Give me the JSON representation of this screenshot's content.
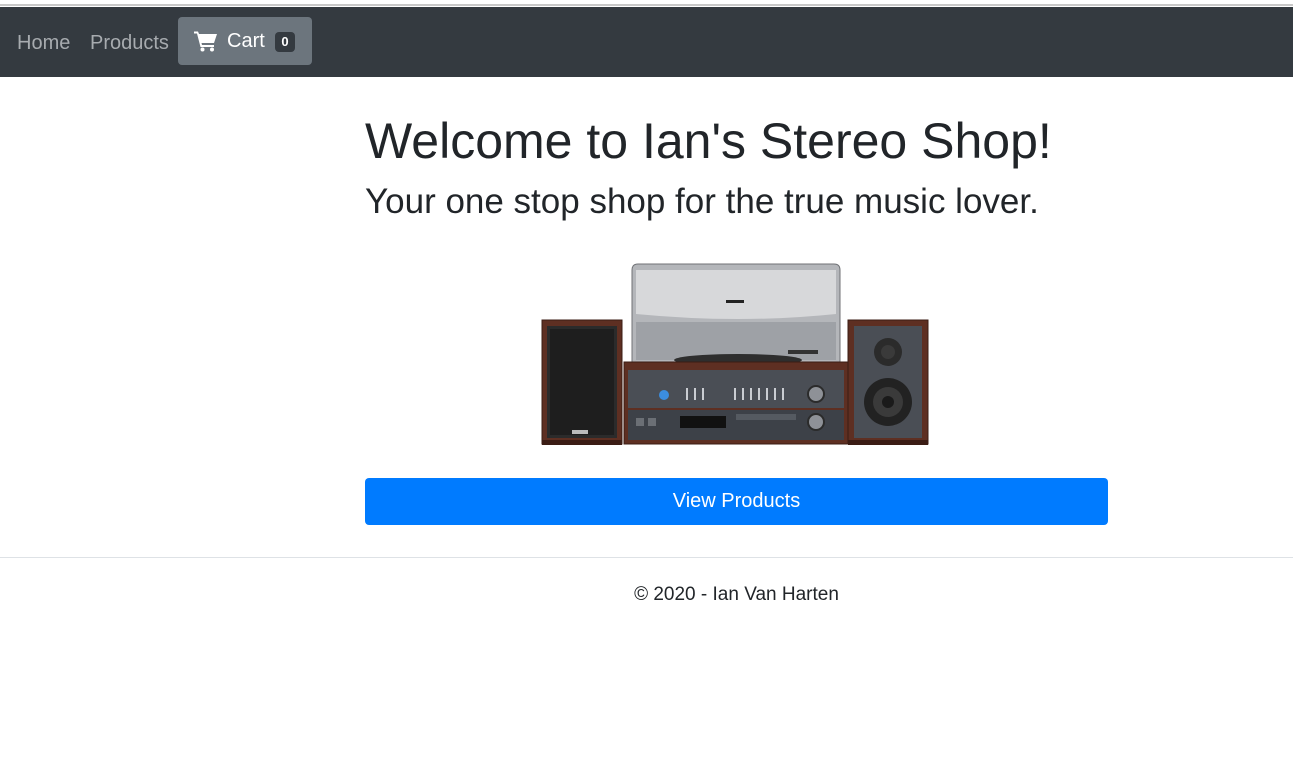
{
  "nav": {
    "home_label": "Home",
    "products_label": "Products",
    "cart_label": "Cart",
    "cart_count": "0",
    "cart_icon": "shopping-cart-icon"
  },
  "hero": {
    "title": "Welcome to Ian's Stereo Shop!",
    "subtitle": "Your one stop shop for the true music lover.",
    "image": "stereo-system-image",
    "button_label": "View Products"
  },
  "footer": {
    "text": "© 2020 - Ian Van Harten"
  },
  "colors": {
    "navbar_bg": "#343a40",
    "cart_button_bg": "#6c757d",
    "primary_button_bg": "#007bff",
    "nav_link_text": "#a7abaf"
  }
}
